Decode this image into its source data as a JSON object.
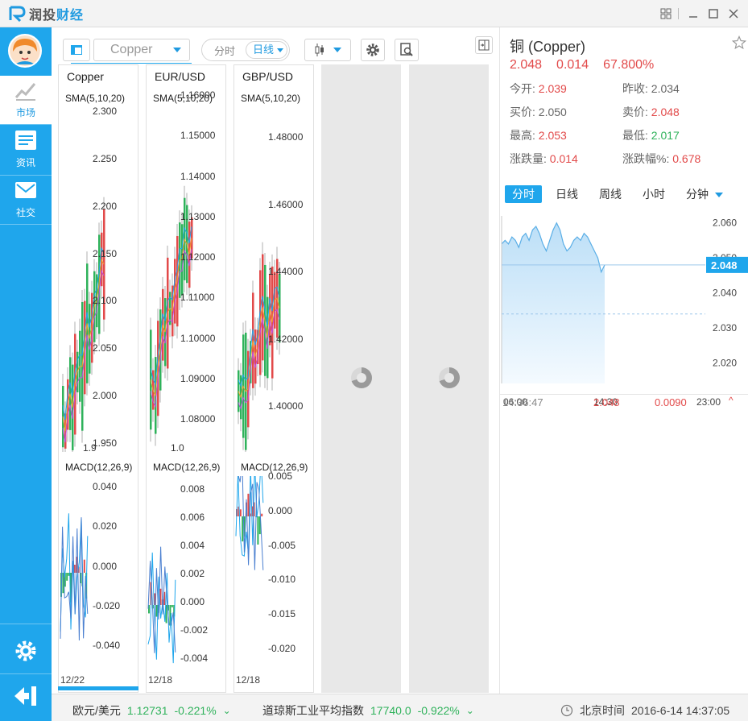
{
  "app": {
    "name_prefix": "润投",
    "name_suffix": "财经"
  },
  "toolbar": {
    "symbol": "Copper",
    "mode_tabs": [
      "分时",
      "日线"
    ],
    "mode_active": "日线"
  },
  "sidebar": {
    "items": [
      {
        "label": "市场",
        "icon": "chart-icon",
        "active": true
      },
      {
        "label": "资讯",
        "icon": "news-icon",
        "active": false
      },
      {
        "label": "社交",
        "icon": "mail-icon",
        "active": false
      }
    ]
  },
  "panels": [
    {
      "name": "Copper",
      "sma": "SMA(5,10,20)",
      "macd": "MACD(12,26,9)",
      "date": "12/22",
      "price_ticks": [
        "2.300",
        "2.250",
        "2.200",
        "2.150",
        "2.100",
        "2.050",
        "2.000",
        "1.950"
      ],
      "macd_ticks": [
        "0.040",
        "0.020",
        "0.000",
        "-0.020",
        "-0.040"
      ],
      "bottom_label": "1.9"
    },
    {
      "name": "EUR/USD",
      "sma": "SMA(5,10,20)",
      "macd": "MACD(12,26,9)",
      "date": "12/18",
      "price_ticks": [
        "1.16000",
        "1.15000",
        "1.14000",
        "1.13000",
        "1.12000",
        "1.11000",
        "1.10000",
        "1.09000",
        "1.08000"
      ],
      "macd_ticks": [
        "0.008",
        "0.006",
        "0.004",
        "0.002",
        "0.000",
        "-0.002",
        "-0.004"
      ],
      "bottom_label": "1.0"
    },
    {
      "name": "GBP/USD",
      "sma": "SMA(5,10,20)",
      "macd": "MACD(12,26,9)",
      "date": "12/18",
      "price_ticks": [
        "1.48000",
        "1.46000",
        "1.44000",
        "1.42000",
        "1.40000"
      ],
      "macd_ticks": [
        "0.005",
        "0.000",
        "-0.005",
        "-0.010",
        "-0.015",
        "-0.020"
      ],
      "bottom_label": ""
    }
  ],
  "quote": {
    "title": "铜 (Copper)",
    "price": "2.048",
    "change": "0.014",
    "change_pct": "67.800%",
    "rows": [
      {
        "l_label": "今开:",
        "l_value": "2.039",
        "l_color": "red",
        "r_label": "昨收:",
        "r_value": "2.034",
        "r_color": "grey"
      },
      {
        "l_label": "买价:",
        "l_value": "2.050",
        "l_color": "grey",
        "r_label": "卖价:",
        "r_value": "2.048",
        "r_color": "red"
      },
      {
        "l_label": "最高:",
        "l_value": "2.053",
        "l_color": "red",
        "r_label": "最低:",
        "r_value": "2.017",
        "r_color": "green"
      },
      {
        "l_label": "涨跌量:",
        "l_value": "0.014",
        "l_color": "red",
        "r_label": "涨跌幅%:",
        "r_value": "0.678",
        "r_color": "red"
      }
    ],
    "tabs": [
      "分时",
      "日线",
      "周线",
      "小时",
      "分钟"
    ],
    "tab_active": "分时"
  },
  "chart_data": {
    "type": "area",
    "x": [
      "06:00",
      "14:30",
      "23:00"
    ],
    "yticks": [
      "2.060",
      "2.050",
      "2.040",
      "2.030",
      "2.020"
    ],
    "ylim": [
      2.016,
      2.062
    ],
    "current": "2.048",
    "prev_close": 2.034,
    "values": [
      2.054,
      2.055,
      2.054,
      2.056,
      2.055,
      2.053,
      2.056,
      2.057,
      2.055,
      2.058,
      2.059,
      2.057,
      2.054,
      2.052,
      2.055,
      2.058,
      2.06,
      2.058,
      2.054,
      2.052,
      2.053,
      2.055,
      2.056,
      2.055,
      2.057,
      2.056,
      2.054,
      2.052,
      2.05,
      2.046,
      2.048
    ]
  },
  "tick": {
    "time": "14:36:47",
    "price": "2.048",
    "volume": "0.0090"
  },
  "statusbar": {
    "eur_name": "欧元/美元",
    "eur_price": "1.12731",
    "eur_change": "-0.221%",
    "dji_name": "道琼斯工业平均指数",
    "dji_price": "17740.0",
    "dji_change": "-0.922%",
    "time_label": "北京时间",
    "time_value": "2016-6-14 14:37:05"
  },
  "colors": {
    "accent": "#1fa6ec",
    "up": "#e24a4a",
    "down": "#2fb25b"
  }
}
